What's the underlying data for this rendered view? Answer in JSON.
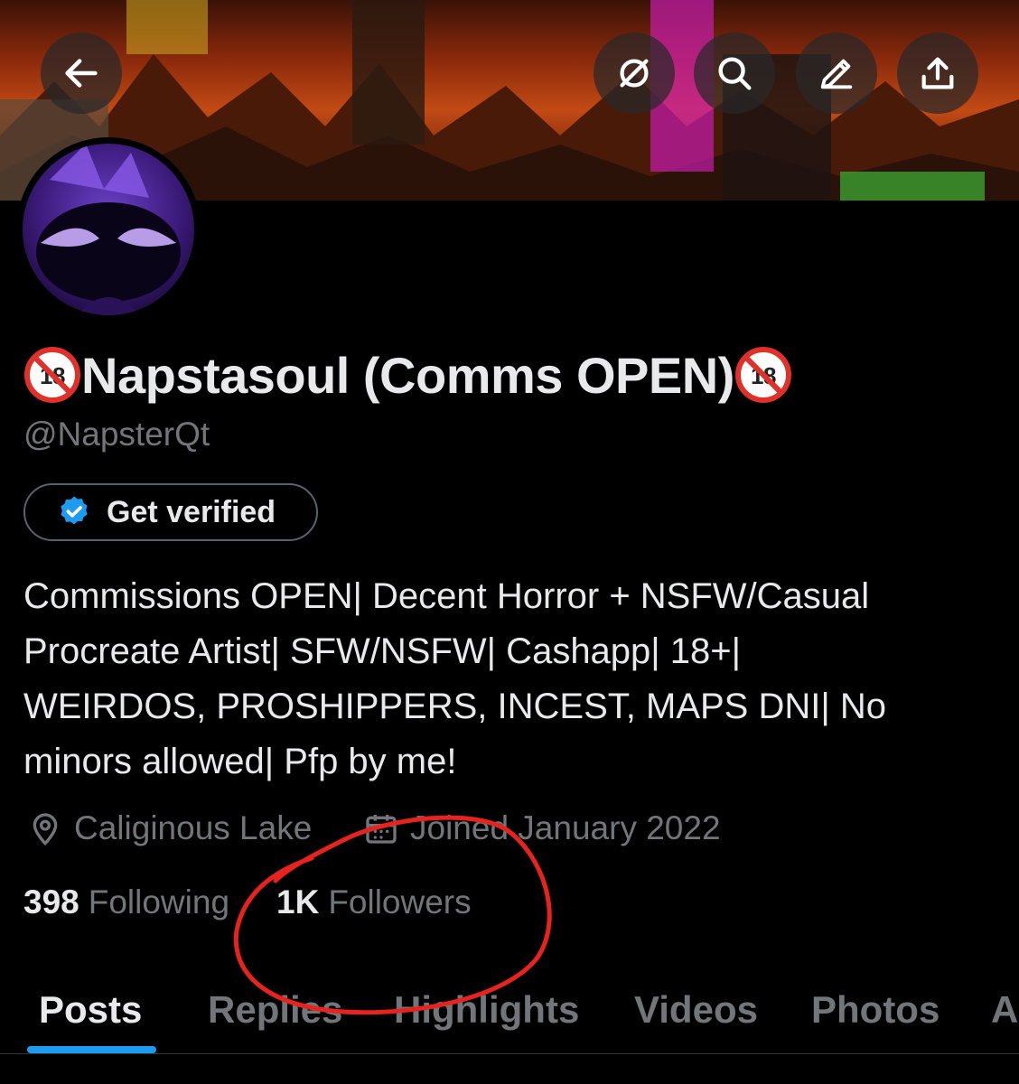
{
  "header": {
    "back_icon": "arrow-left-icon",
    "grok_icon": "grok-icon",
    "search_icon": "search-icon",
    "edit_icon": "edit-icon",
    "share_icon": "share-icon"
  },
  "profile": {
    "name_prefix_emoji": "🔞",
    "name": "Napstasoul (Comms OPEN)",
    "name_suffix_emoji": "🔞",
    "handle": "@NapsterQt",
    "verify_label": "Get verified",
    "bio_lines": [
      "Commissions OPEN| Decent Horror + NSFW/Casual",
      "Procreate Artist| SFW/NSFW| Cashapp| 18+|",
      "WEIRDOS, PROSHIPPERS, INCEST, MAPS DNI| No",
      "minors allowed| Pfp by me!"
    ],
    "location": "Caliginous Lake",
    "joined": "Joined January 2022",
    "following_count": "398",
    "following_label": "Following",
    "followers_count": "1K",
    "followers_label": "Followers"
  },
  "tabs": [
    "Posts",
    "Replies",
    "Highlights",
    "Videos",
    "Photos",
    "A"
  ],
  "colors": {
    "accent": "#1d9bf0",
    "background": "#000000",
    "text_primary": "#e7e9ea",
    "text_secondary": "#71767b",
    "annotation_circle": "#e8231d"
  }
}
